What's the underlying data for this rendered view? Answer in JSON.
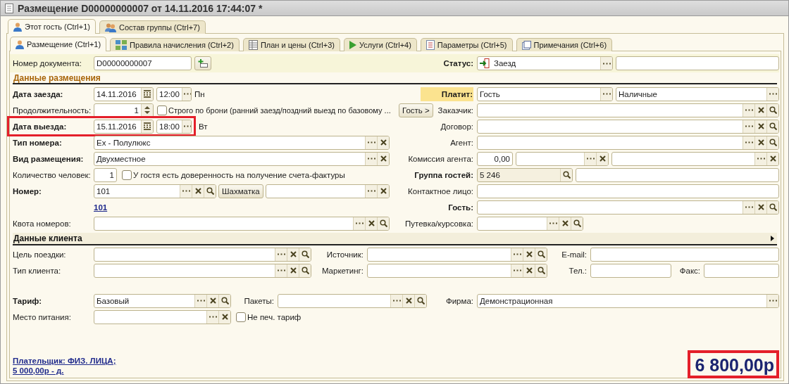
{
  "window": {
    "title": "Размещение D00000000007 от 14.11.2016 17:44:07 *"
  },
  "outer_tabs": [
    {
      "label": "Этот гость (Ctrl+1)",
      "selected": true
    },
    {
      "label": "Состав группы (Ctrl+7)",
      "selected": false
    }
  ],
  "inner_tabs": [
    {
      "label": "Размещение (Ctrl+1)",
      "selected": true
    },
    {
      "label": "Правила начисления (Ctrl+2)",
      "selected": false
    },
    {
      "label": "План и цены (Ctrl+3)",
      "selected": false
    },
    {
      "label": "Услуги (Ctrl+4)",
      "selected": false
    },
    {
      "label": "Параметры (Ctrl+5)",
      "selected": false
    },
    {
      "label": "Примечания (Ctrl+6)",
      "selected": false
    }
  ],
  "doc_number": {
    "label": "Номер документа:",
    "value": "D00000000007"
  },
  "status": {
    "label": "Статус:",
    "value": "Заезд",
    "buttons": [
      {
        "kind": "choose"
      }
    ]
  },
  "placement_section": {
    "title": "Данные размещения"
  },
  "check_in": {
    "label": "Дата заезда:",
    "date": "14.11.2016",
    "time": "12:00",
    "weekday": "Пн",
    "marked": false
  },
  "duration": {
    "label": "Продолжительность:",
    "value": "1",
    "strict": {
      "label": "Строго по брони (ранний заезд/поздний выезд по базовому ...",
      "checked": false
    }
  },
  "check_out": {
    "label": "Дата выезда:",
    "date": "15.11.2016",
    "time": "18:00",
    "weekday": "Вт",
    "marked": true
  },
  "room_type": {
    "label": "Тип номера:",
    "value": "Ex - Полулюкс",
    "buttons": [
      {
        "kind": "choose"
      },
      {
        "kind": "clear"
      }
    ]
  },
  "placement_kind": {
    "label": "Вид размещения:",
    "value": "Двухместное",
    "buttons": [
      {
        "kind": "choose"
      },
      {
        "kind": "clear"
      }
    ]
  },
  "guests_count": {
    "label": "Количество человек:",
    "value": "1",
    "proxy": {
      "label": "У гостя есть доверенность на получение счета-фактуры",
      "checked": false
    }
  },
  "room": {
    "label": "Номер:",
    "value": "101",
    "buttons": [
      {
        "kind": "choose"
      },
      {
        "kind": "clear"
      },
      {
        "kind": "search"
      }
    ],
    "chess_button": "Шахматка",
    "extra_buttons": [
      {
        "kind": "choose"
      },
      {
        "kind": "clear"
      }
    ],
    "link": "101"
  },
  "quota": {
    "label": "Квота номеров:",
    "buttons": [
      {
        "kind": "choose"
      },
      {
        "kind": "clear"
      },
      {
        "kind": "search"
      }
    ]
  },
  "payer": {
    "label": "Платит:",
    "highlighted": true,
    "value": "Гость",
    "buttons": [
      {
        "kind": "choose"
      }
    ],
    "method": "Наличные",
    "method_buttons": [
      {
        "kind": "choose"
      }
    ]
  },
  "customer": {
    "label": "Заказчик:",
    "guest_button": "Гость >",
    "buttons": [
      {
        "kind": "choose"
      },
      {
        "kind": "clear"
      },
      {
        "kind": "search"
      }
    ]
  },
  "contract": {
    "label": "Договор:",
    "buttons": [
      {
        "kind": "choose"
      },
      {
        "kind": "clear"
      },
      {
        "kind": "search"
      }
    ]
  },
  "agent": {
    "label": "Агент:",
    "buttons": [
      {
        "kind": "choose"
      },
      {
        "kind": "clear"
      },
      {
        "kind": "search"
      }
    ]
  },
  "commission": {
    "label": "Комиссия агента:",
    "value": "0,00",
    "second_buttons": [
      {
        "kind": "choose"
      },
      {
        "kind": "clear"
      }
    ],
    "third_buttons": [
      {
        "kind": "choose"
      },
      {
        "kind": "clear"
      }
    ]
  },
  "guest_group": {
    "label": "Группа гостей:",
    "value": "5 246",
    "read_only": true,
    "buttons": [
      {
        "kind": "search"
      }
    ]
  },
  "contact": {
    "label": "Контактное лицо:"
  },
  "guest": {
    "label": "Гость:",
    "buttons": [
      {
        "kind": "choose"
      },
      {
        "kind": "clear"
      },
      {
        "kind": "search"
      }
    ]
  },
  "voucher": {
    "label": "Путевка/курсовка:",
    "buttons": [
      {
        "kind": "choose"
      },
      {
        "kind": "clear"
      },
      {
        "kind": "search"
      }
    ]
  },
  "client_section": {
    "title": "Данные клиента"
  },
  "trip_purpose": {
    "label": "Цель поездки:",
    "buttons": [
      {
        "kind": "choose"
      },
      {
        "kind": "clear"
      },
      {
        "kind": "search"
      }
    ]
  },
  "source": {
    "label": "Источник:",
    "buttons": [
      {
        "kind": "choose"
      },
      {
        "kind": "clear"
      },
      {
        "kind": "search"
      }
    ]
  },
  "email": {
    "label": "E-mail:"
  },
  "client_type": {
    "label": "Тип клиента:",
    "buttons": [
      {
        "kind": "choose"
      },
      {
        "kind": "clear"
      },
      {
        "kind": "search"
      }
    ]
  },
  "marketing": {
    "label": "Маркетинг:",
    "buttons": [
      {
        "kind": "choose"
      },
      {
        "kind": "clear"
      },
      {
        "kind": "search"
      }
    ]
  },
  "phone": {
    "label": "Тел.:"
  },
  "fax": {
    "label": "Факс:"
  },
  "tariff": {
    "label": "Тариф:",
    "value": "Базовый",
    "buttons": [
      {
        "kind": "choose"
      },
      {
        "kind": "clear"
      },
      {
        "kind": "search"
      }
    ]
  },
  "packages": {
    "label": "Пакеты:",
    "buttons": [
      {
        "kind": "choose"
      },
      {
        "kind": "clear"
      },
      {
        "kind": "search"
      }
    ]
  },
  "firm": {
    "label": "Фирма:",
    "value": "Демонстрационная",
    "buttons": [
      {
        "kind": "choose"
      }
    ]
  },
  "meal_place": {
    "label": "Место питания:",
    "buttons": [
      {
        "kind": "choose"
      },
      {
        "kind": "clear"
      }
    ]
  },
  "no_print_tariff": {
    "label": "Не печ. тариф",
    "checked": false
  },
  "footer": {
    "payer_link": "Плательщик: ФИЗ. ЛИЦА;",
    "amount_link": "5 000,00р - д.",
    "total": "6 800,00р",
    "total_marked": true
  }
}
